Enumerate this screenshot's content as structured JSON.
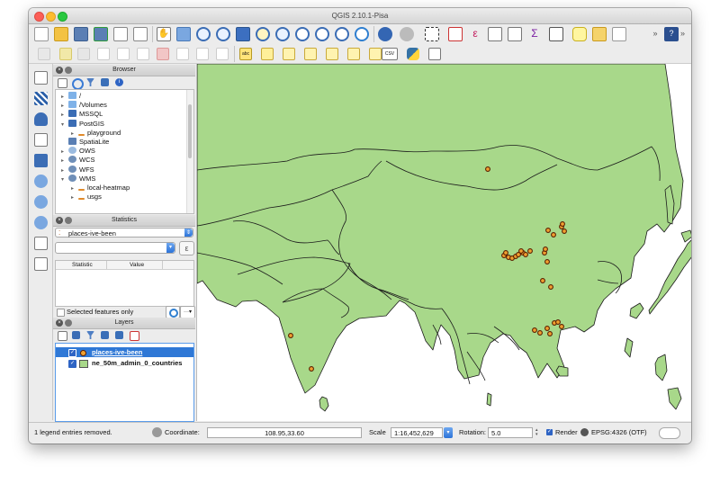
{
  "window": {
    "title": "QGIS 2.10.1-Pisa"
  },
  "browser_panel": {
    "title": "Browser",
    "items": [
      {
        "label": "/",
        "icon": "folder-icon"
      },
      {
        "label": "/Volumes",
        "icon": "folder-icon"
      },
      {
        "label": "MSSQL",
        "icon": "mssql-icon"
      },
      {
        "label": "PostGIS",
        "icon": "postgis-icon"
      },
      {
        "label": "playground",
        "icon": "connection-icon"
      },
      {
        "label": "SpatiaLite",
        "icon": "spatialite-icon"
      },
      {
        "label": "OWS",
        "icon": "ows-icon"
      },
      {
        "label": "WCS",
        "icon": "globe-icon"
      },
      {
        "label": "WFS",
        "icon": "globe-icon"
      },
      {
        "label": "WMS",
        "icon": "globe-icon"
      },
      {
        "label": "local-heatmap",
        "icon": "connection-icon"
      },
      {
        "label": "usgs",
        "icon": "connection-icon"
      }
    ]
  },
  "statistics_panel": {
    "title": "Statistics",
    "layer": "places-ive-been",
    "field": "",
    "columns": [
      "Statistic",
      "Value"
    ],
    "selected_only_label": "Selected features only"
  },
  "layers_panel": {
    "title": "Layers",
    "layers": [
      {
        "label": "places-ive-been",
        "checked": true,
        "selected": true
      },
      {
        "label": "ne_50m_admin_0_countries",
        "checked": true,
        "selected": false
      }
    ]
  },
  "status_bar": {
    "message": "1 legend entries removed.",
    "coordinate_label": "Coordinate:",
    "coordinate_value": "108.95,33.60",
    "scale_label": "Scale",
    "scale_value": "1:16,452,629",
    "rotation_label": "Rotation:",
    "rotation_value": "5.0",
    "render_label": "Render",
    "crs": "EPSG:4326 (OTF)"
  },
  "map": {
    "land_color": "#a8d88a",
    "water_color": "#ffffff",
    "point_color": "#f0a030",
    "point_outline": "#5a1e00"
  }
}
